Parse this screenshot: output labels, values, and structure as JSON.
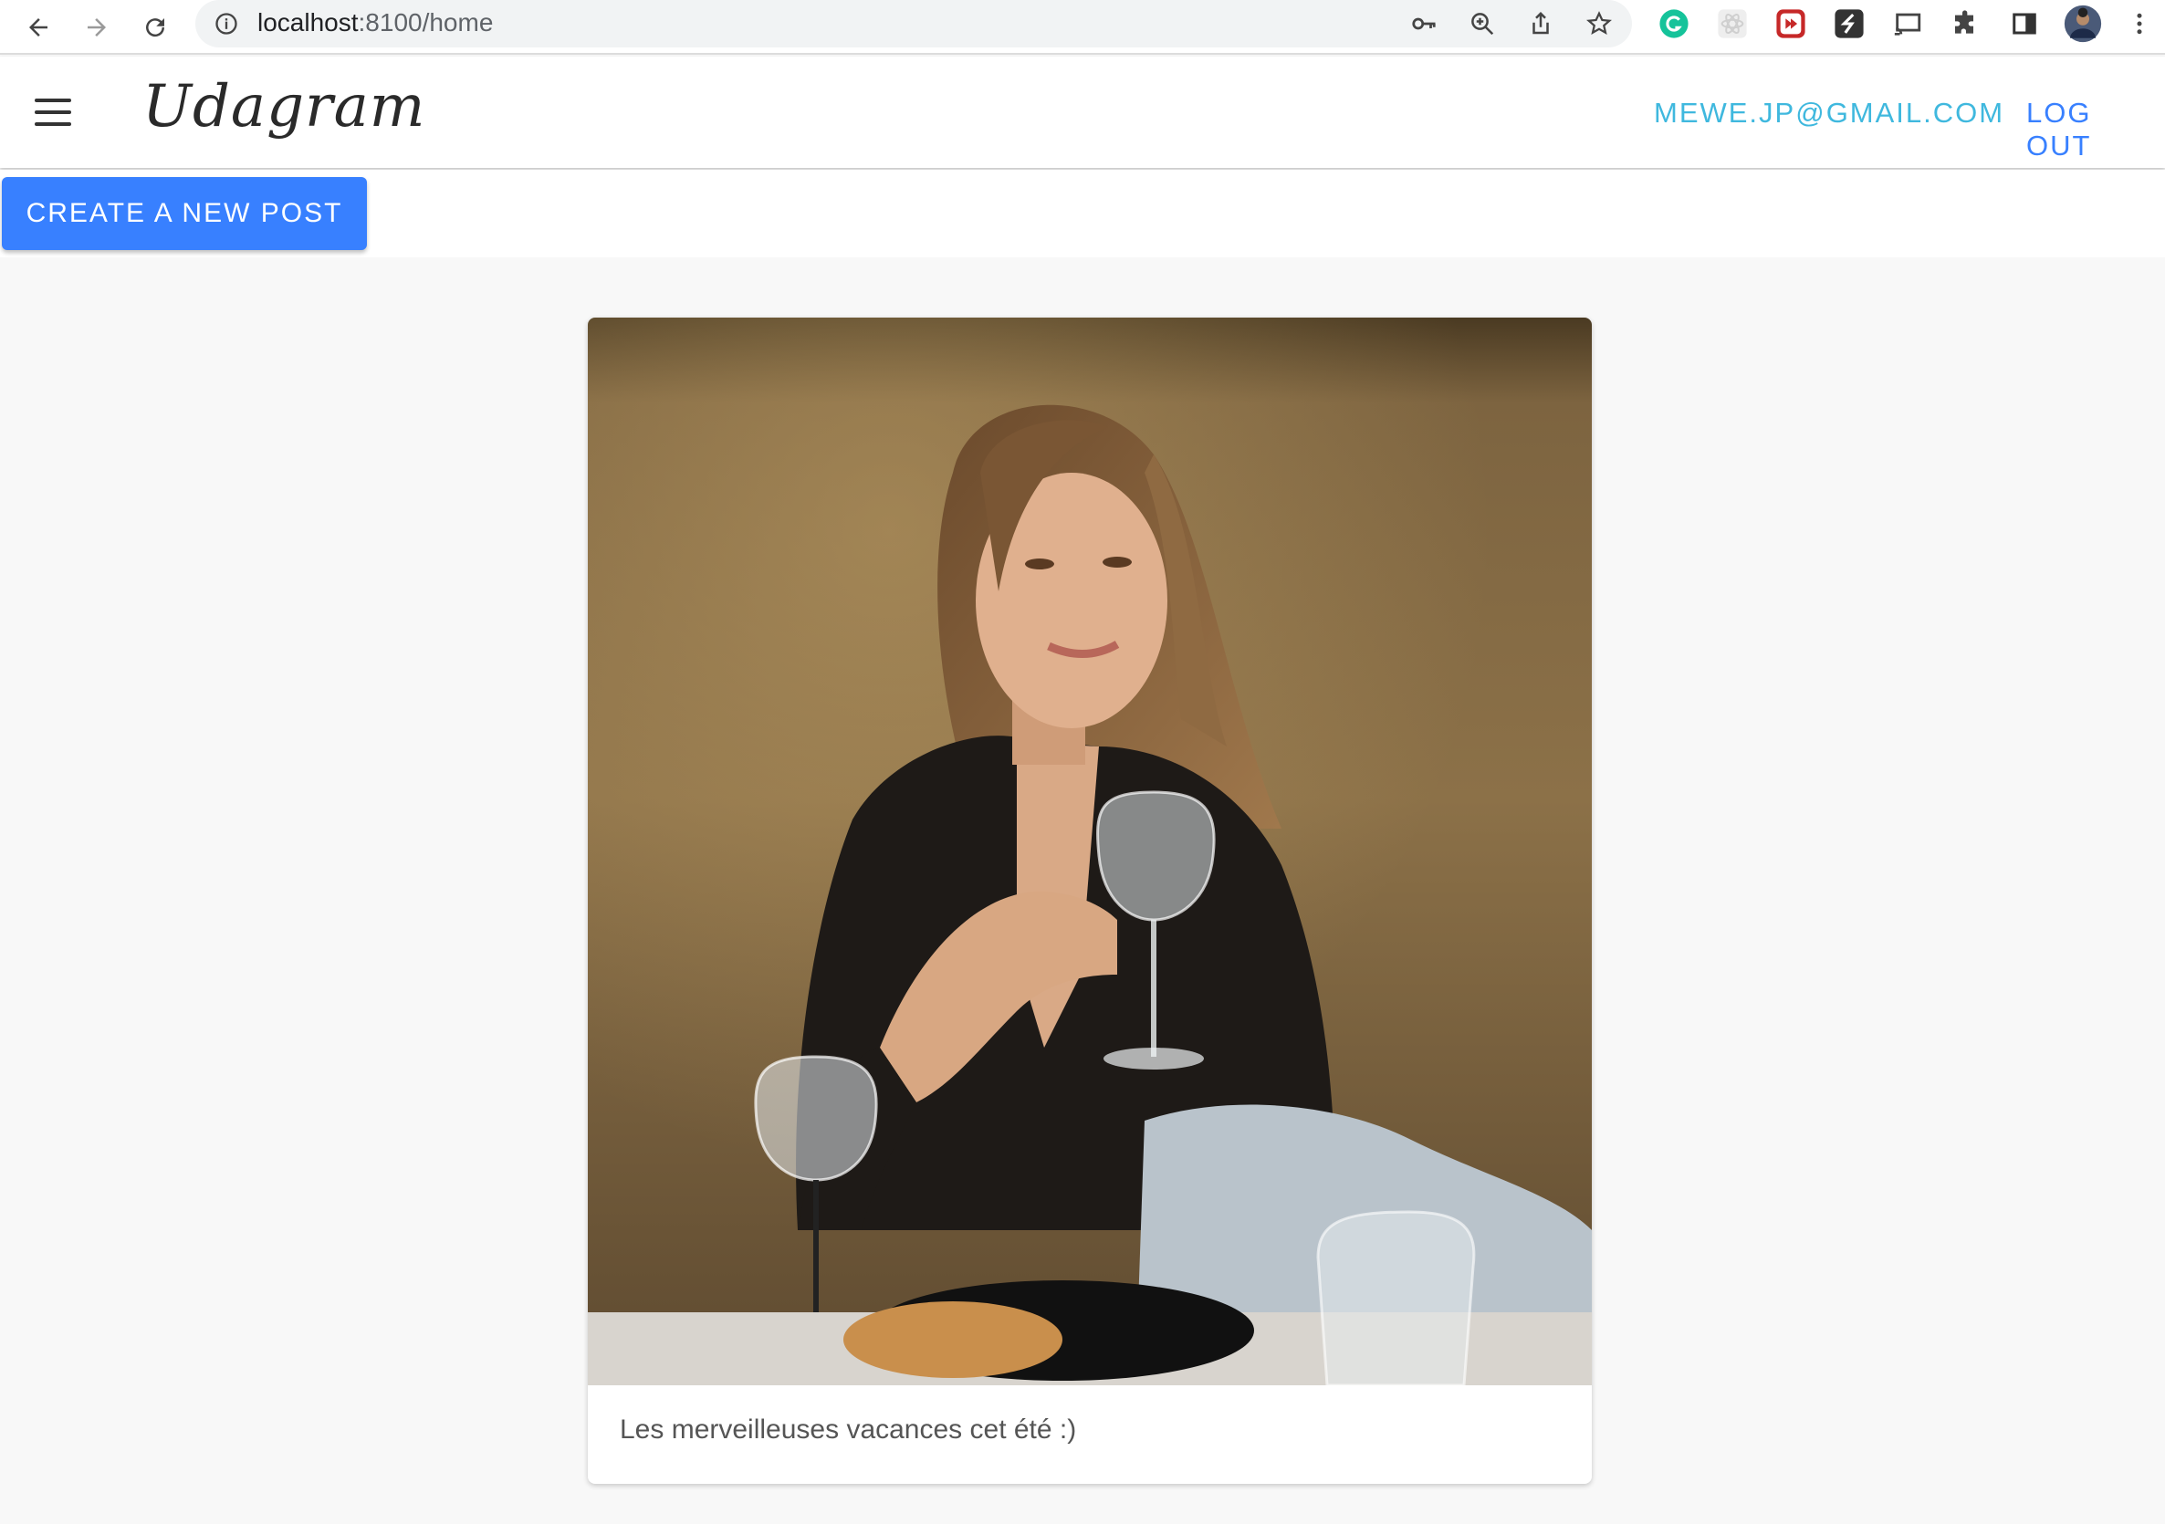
{
  "browser": {
    "url_host": "localhost",
    "url_path": ":8100/home"
  },
  "header": {
    "logo": "Udagram",
    "user_email": "MEWE.JP@GMAIL.COM",
    "logout_label": "LOG OUT"
  },
  "toolbar": {
    "create_label": "CREATE A NEW POST"
  },
  "feed": {
    "items": [
      {
        "caption": "Les merveilleuses vacances cet été :)"
      }
    ]
  },
  "colors": {
    "primary": "#3880ff",
    "email": "#3fb8de"
  }
}
